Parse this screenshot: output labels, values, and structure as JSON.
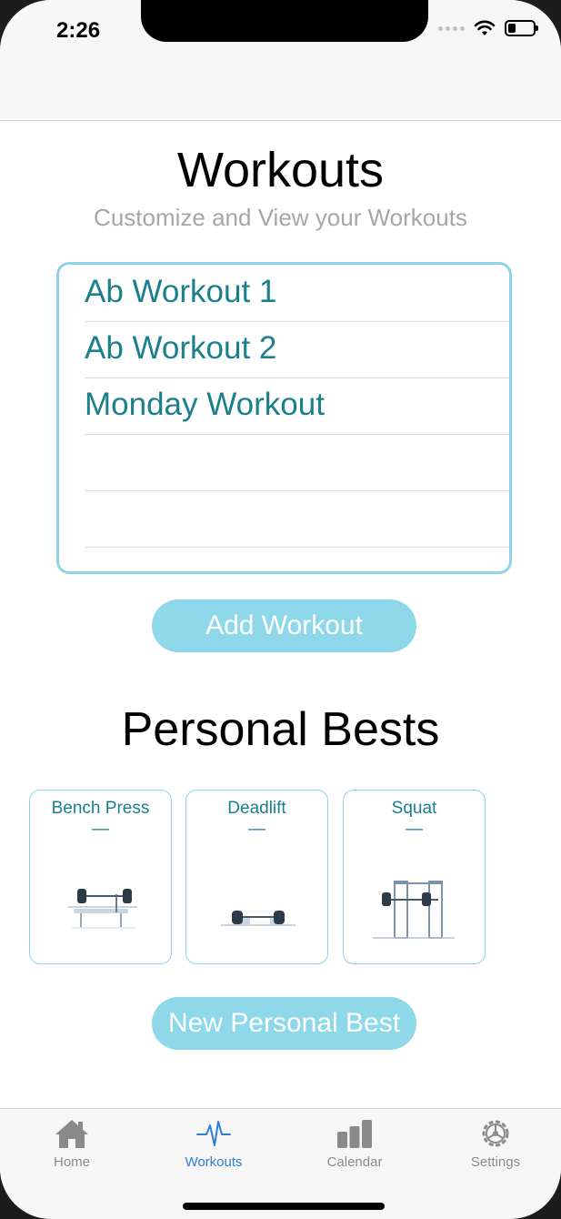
{
  "status": {
    "time": "2:26",
    "battery_level": 0.3
  },
  "header": {
    "title": "Workouts",
    "subtitle": "Customize and View your Workouts"
  },
  "workouts": [
    "Ab Workout 1",
    "Ab Workout 2",
    "Monday Workout",
    "",
    ""
  ],
  "buttons": {
    "add_workout": "Add Workout",
    "new_personal_best": "New Personal Best"
  },
  "personal_bests": {
    "title": "Personal Bests",
    "cards": [
      {
        "name": "Bench Press",
        "value": "—",
        "icon": "bench-press-icon"
      },
      {
        "name": "Deadlift",
        "value": "—",
        "icon": "deadlift-icon"
      },
      {
        "name": "Squat",
        "value": "—",
        "icon": "squat-rack-icon"
      }
    ]
  },
  "tabs": [
    {
      "label": "Home",
      "icon": "home-icon",
      "active": false
    },
    {
      "label": "Workouts",
      "icon": "heartbeat-icon",
      "active": true
    },
    {
      "label": "Calendar",
      "icon": "bar-chart-icon",
      "active": false
    },
    {
      "label": "Settings",
      "icon": "gear-icon",
      "active": false
    }
  ],
  "colors": {
    "accent": "#8ed8ea",
    "text_teal": "#1b7f8c",
    "active_tab": "#2f7fd6"
  }
}
